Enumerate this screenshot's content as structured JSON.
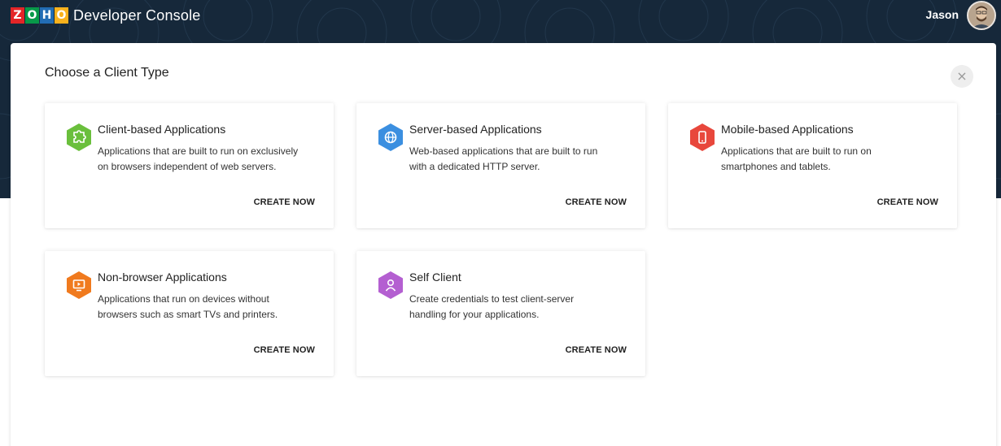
{
  "header": {
    "logo_letters": [
      "Z",
      "O",
      "H",
      "O"
    ],
    "logo_colors": [
      "#e42527",
      "#089949",
      "#226db4",
      "#f9b21d"
    ],
    "app_title": "Developer Console",
    "user_name": "Jason"
  },
  "modal": {
    "title": "Choose a Client Type",
    "close_symbol": "×",
    "cards": [
      {
        "title": "Client-based Applications",
        "description": "Applications that are built to run on exclusively on browsers independent of web servers.",
        "action": "CREATE NOW",
        "icon": "puzzle-icon",
        "color": "#6abf3c"
      },
      {
        "title": "Server-based Applications",
        "description": "Web-based applications that are built to run with a dedicated HTTP server.",
        "action": "CREATE NOW",
        "icon": "globe-icon",
        "color": "#3b8fe0"
      },
      {
        "title": "Mobile-based Applications",
        "description": "Applications that are built to run on smartphones and tablets.",
        "action": "CREATE NOW",
        "icon": "mobile-icon",
        "color": "#e8473c"
      },
      {
        "title": "Non-browser Applications",
        "description": "Applications that run on devices without browsers such as smart TVs and printers.",
        "action": "CREATE NOW",
        "icon": "monitor-icon",
        "color": "#f07a1e"
      },
      {
        "title": "Self Client",
        "description": "Create credentials to test client-server handling for your applications.",
        "action": "CREATE NOW",
        "icon": "user-icon",
        "color": "#b45fd1"
      }
    ]
  }
}
